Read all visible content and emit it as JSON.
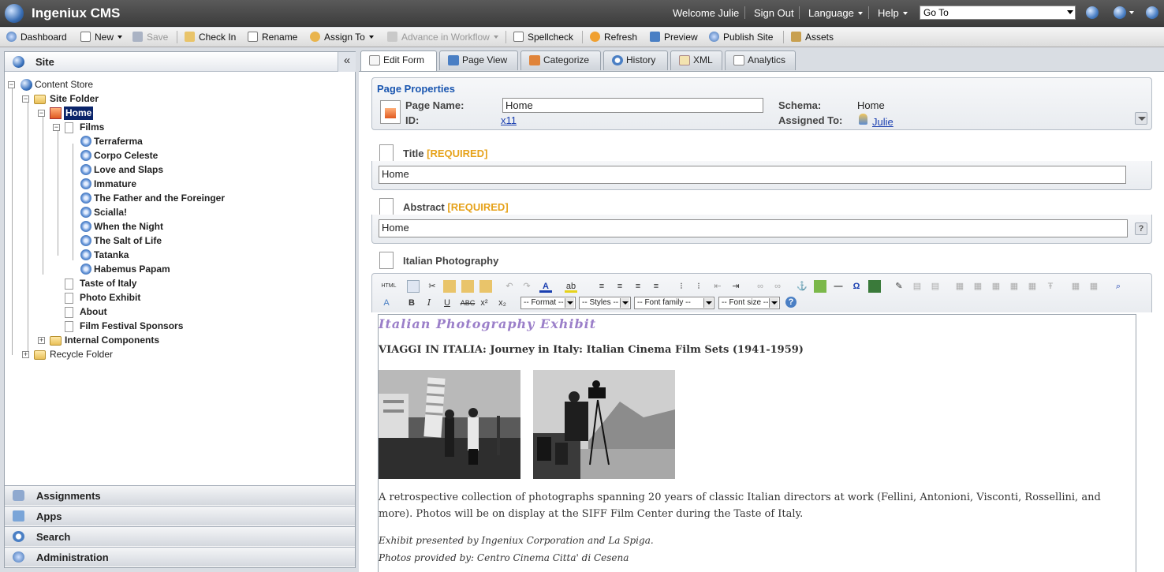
{
  "app": {
    "title": "Ingeniux CMS"
  },
  "topbar": {
    "welcome": "Welcome Julie",
    "sign_out": "Sign Out",
    "language": "Language",
    "help": "Help",
    "goto_value": "Go To"
  },
  "toolbar": {
    "dashboard": "Dashboard",
    "new": "New",
    "save": "Save",
    "check_in": "Check In",
    "rename": "Rename",
    "assign_to": "Assign To",
    "advance": "Advance in Workflow",
    "spellcheck": "Spellcheck",
    "refresh": "Refresh",
    "preview": "Preview",
    "publish_site": "Publish Site",
    "assets": "Assets"
  },
  "left": {
    "site_title": "Site",
    "tree": {
      "content_store": "Content Store",
      "site_folder": "Site Folder",
      "home": "Home",
      "films": "Films",
      "film_items": [
        "Terraferma",
        "Corpo Celeste",
        "Love and Slaps",
        "Immature",
        "The Father and the Foreinger",
        "Scialla!",
        "When the Night",
        "The Salt of Life",
        "Tatanka",
        "Habemus Papam"
      ],
      "taste_of_italy": "Taste of Italy",
      "photo_exhibit": "Photo Exhibit",
      "about": "About",
      "sponsors": "Film Festival Sponsors",
      "internal": "Internal Components",
      "recycle": "Recycle Folder"
    },
    "accordion": [
      "Assignments",
      "Apps",
      "Search",
      "Administration"
    ]
  },
  "tabs": [
    "Edit Form",
    "Page View",
    "Categorize",
    "History",
    "XML",
    "Analytics"
  ],
  "page_properties": {
    "heading": "Page Properties",
    "name_label": "Page Name:",
    "name_value": "Home",
    "id_label": "ID:",
    "id_value": "x11",
    "schema_label": "Schema:",
    "schema_value": "Home",
    "assigned_label": "Assigned To:",
    "assigned_value": "Julie"
  },
  "fields": {
    "title_label": "Title",
    "title_req": "[REQUIRED]",
    "title_value": "Home",
    "abstract_label": "Abstract",
    "abstract_req": "[REQUIRED]",
    "abstract_value": "Home",
    "rte_label": "Italian Photography",
    "help_q": "?"
  },
  "rte": {
    "format": "-- Format --",
    "styles": "-- Styles --",
    "font_family": "-- Font family --",
    "font_size": "-- Font size --"
  },
  "content": {
    "heading": "Italian Photography Exhibit",
    "subheading": "VIAGGI IN ITALIA: Journey in Italy: Italian Cinema Film Sets (1941-1959)",
    "paragraph": "A retrospective collection of photographs spanning 20 years of classic Italian directors at work (Fellini, Antonioni, Visconti, Rossellini, and more). Photos will be on display at the SIFF Film Center during the Taste of Italy.",
    "credit1": "Exhibit presented by Ingeniux Corporation and La Spiga.",
    "credit2": "Photos provided by: Centro Cinema Citta' di Cesena"
  }
}
